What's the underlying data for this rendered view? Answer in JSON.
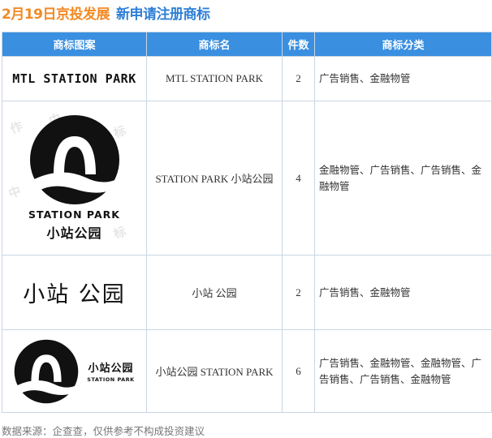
{
  "header": {
    "company": "2月19日京投发展",
    "subject": "新申请注册商标"
  },
  "table": {
    "columns": [
      "商标图案",
      "商标名",
      "件数",
      "商标分类"
    ],
    "rows": [
      {
        "logo_text": "MTL STATION PARK",
        "name": "MTL STATION PARK",
        "count": "2",
        "classes": "广告销售、金融物管"
      },
      {
        "logo_en": "STATION PARK",
        "logo_cn": "小站公园",
        "name": "STATION PARK 小站公园",
        "count": "4",
        "classes": "金融物管、广告销售、广告销售、金融物管"
      },
      {
        "logo_text": "小站 公园",
        "name": "小站 公园",
        "count": "2",
        "classes": "广告销售、金融物管"
      },
      {
        "logo_cn": "小站公园",
        "logo_en": "STATION PARK",
        "name": "小站公园 STATION PARK",
        "count": "6",
        "classes": "广告销售、金融物管、金融物管、广告销售、广告销售、金融物管"
      }
    ]
  },
  "footer": {
    "source": "数据来源：企查查，仅供参考不构成投资建议"
  }
}
